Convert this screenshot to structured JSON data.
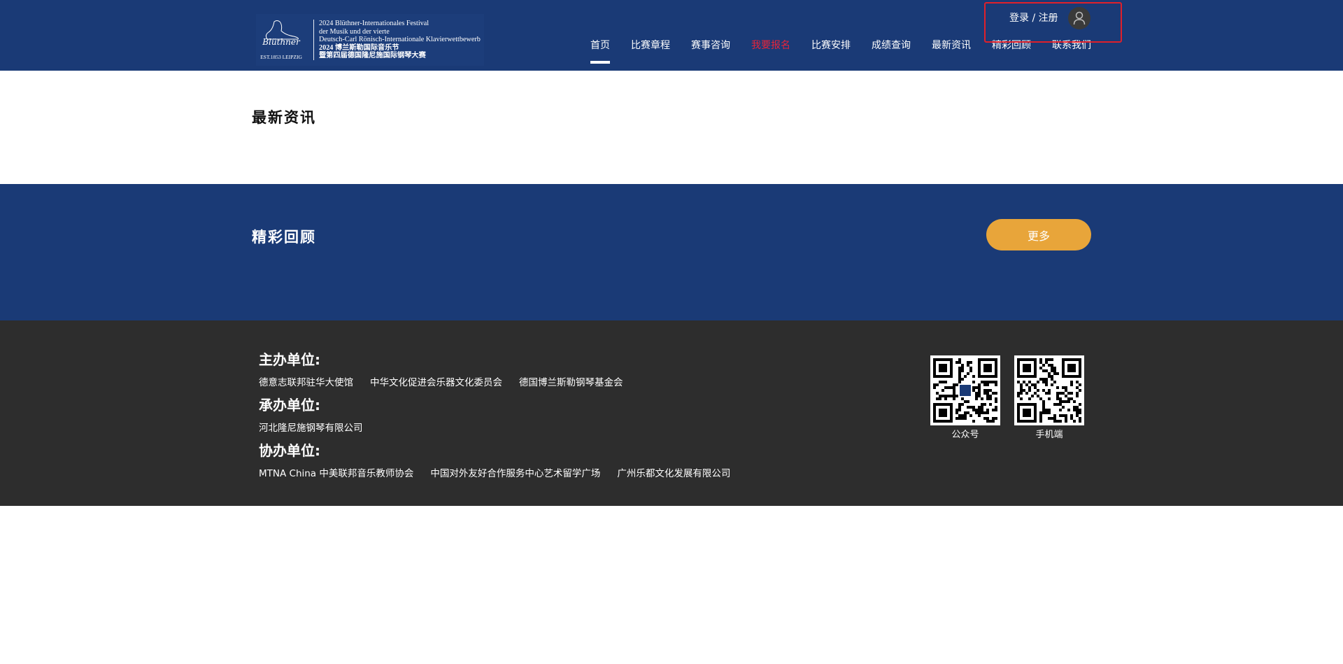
{
  "header": {
    "logo": {
      "brand": "Blüthner",
      "est": "EST.1853 LEIPZIG",
      "lines": [
        "2024 Blüthner-Internationales Festival",
        "der Musik und der vierte",
        "Deutsch-Carl Rönisch-Internationale Klavierwettbewerb",
        "2024 博兰斯勒国际音乐节",
        "暨第四届德国隆尼施国际钢琴大赛"
      ]
    },
    "nav": [
      {
        "label": "首页",
        "active": true
      },
      {
        "label": "比赛章程"
      },
      {
        "label": "赛事咨询"
      },
      {
        "label": "我要报名",
        "highlight": true
      },
      {
        "label": "比赛安排"
      },
      {
        "label": "成绩查询"
      },
      {
        "label": "最新资讯"
      },
      {
        "label": "精彩回顾"
      },
      {
        "label": "联系我们"
      }
    ],
    "login_label": "登录 / 注册"
  },
  "news": {
    "title": "最新资讯"
  },
  "review": {
    "title": "精彩回顾",
    "more_label": "更多"
  },
  "footer": {
    "organizer_heading": "主办单位:",
    "organizers": [
      "德意志联邦驻华大使馆",
      "中华文化促进会乐器文化委员会",
      "德国博兰斯勒钢琴基金会"
    ],
    "undertaker_heading": "承办单位:",
    "undertakers": [
      "河北隆尼施钢琴有限公司"
    ],
    "coorganizer_heading": "协办单位:",
    "coorganizers": [
      "MTNA China 中美联邦音乐教师协会",
      "中国对外友好合作服务中心艺术留学广场",
      "广州乐都文化发展有限公司"
    ],
    "qr_codes": [
      {
        "label": "公众号"
      },
      {
        "label": "手机端"
      }
    ]
  },
  "colors": {
    "header_bg": "#1a3a76",
    "footer_bg": "#2d2d2d",
    "accent_orange": "#e8a53a",
    "accent_red": "#e8243a"
  }
}
